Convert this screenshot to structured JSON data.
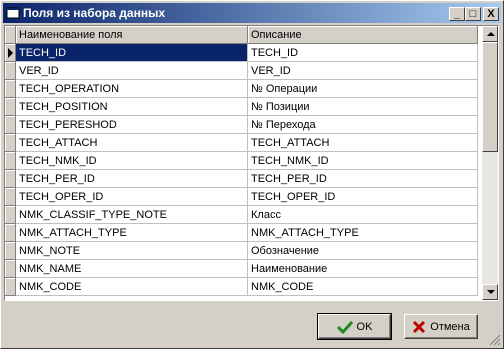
{
  "window": {
    "title": "Поля из набора данных",
    "controls": {
      "minimize": "_",
      "maximize": "□",
      "close": "X"
    }
  },
  "grid": {
    "columns": [
      "Наименование поля",
      "Описание"
    ],
    "selected_row": 0,
    "rows": [
      [
        "TECH_ID",
        "TECH_ID"
      ],
      [
        "VER_ID",
        "VER_ID"
      ],
      [
        "TECH_OPERATION",
        "№ Операции"
      ],
      [
        "TECH_POSITION",
        "№ Позиции"
      ],
      [
        "TECH_PERESHOD",
        "№ Перехода"
      ],
      [
        "TECH_ATTACH",
        "TECH_ATTACH"
      ],
      [
        "TECH_NMK_ID",
        "TECH_NMK_ID"
      ],
      [
        "TECH_PER_ID",
        "TECH_PER_ID"
      ],
      [
        "TECH_OPER_ID",
        "TECH_OPER_ID"
      ],
      [
        "NMK_CLASSIF_TYPE_NOTE",
        "Класс"
      ],
      [
        "NMK_ATTACH_TYPE",
        "NMK_ATTACH_TYPE"
      ],
      [
        "NMK_NOTE",
        "Обозначение"
      ],
      [
        "NMK_NAME",
        "Наименование"
      ],
      [
        "NMK_CODE",
        "NMK_CODE"
      ]
    ]
  },
  "buttons": {
    "ok": {
      "label": "OK",
      "icon": "checkmark-icon"
    },
    "cancel": {
      "label": "Отмена",
      "icon": "x-icon"
    }
  },
  "colors": {
    "selection": "#0a246a",
    "title_gradient_start": "#0a246a",
    "title_gradient_end": "#a6caf0",
    "ok_check": "#1c8a1c",
    "cancel_x": "#c00000"
  }
}
